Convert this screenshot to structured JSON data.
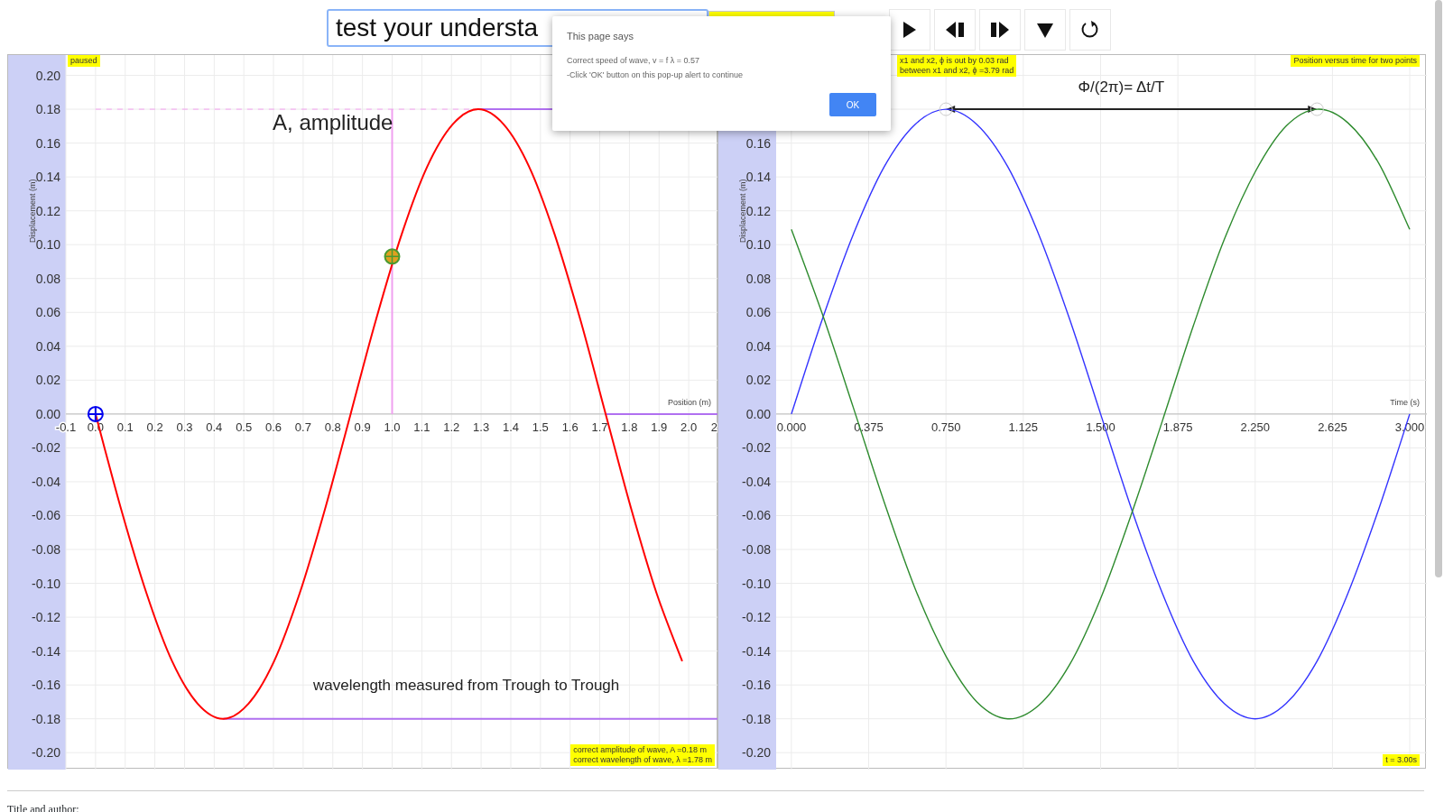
{
  "toolbar": {
    "question_select": {
      "value": "test your understa"
    },
    "buttons": [
      {
        "kind": "play"
      },
      {
        "kind": "step-back"
      },
      {
        "kind": "step-forward"
      },
      {
        "kind": "down"
      },
      {
        "kind": "reset"
      }
    ]
  },
  "dialog": {
    "title": "This page says",
    "message": [
      "Correct speed of wave, v = f λ = 0.57",
      "-Click 'OK' button on this pop-up alert to continue"
    ],
    "button": "OK"
  },
  "charts": [
    {
      "status": "paused",
      "notes": [
        "correct amplitude of wave, A =0.18 m",
        "correct wavelength of wave, λ =1.78 m"
      ],
      "chart_data": {
        "type": "line",
        "xlabel": "Position (m)",
        "ylabel": "Displacement (m)",
        "x": [
          0,
          0.086,
          0.172,
          0.258,
          0.344,
          0.43,
          0.516,
          0.602,
          0.688,
          0.774,
          0.86,
          0.946,
          1.032,
          1.118,
          1.204,
          1.29,
          1.376,
          1.462,
          1.548,
          1.634,
          1.72,
          1.806,
          1.892,
          1.978
        ],
        "series": [
          {
            "color": "#ff0000",
            "values": [
              0,
              -0.056,
              -0.106,
              -0.146,
              -0.171,
              -0.18,
              -0.171,
              -0.146,
              -0.106,
              -0.056,
              0,
              0.056,
              0.106,
              0.146,
              0.171,
              0.18,
              0.171,
              0.146,
              0.106,
              0.056,
              0,
              -0.056,
              -0.106,
              -0.146
            ]
          }
        ],
        "xlim": [
          -0.1,
          2.1
        ],
        "ylim": [
          -0.21,
          0.212
        ],
        "xticks": [
          {
            "value": -0.1,
            "label": "-0.1"
          },
          {
            "value": 0,
            "label": "0.0"
          },
          {
            "value": 0.1,
            "label": "0.1"
          },
          {
            "value": 0.2,
            "label": "0.2"
          },
          {
            "value": 0.3,
            "label": "0.3"
          },
          {
            "value": 0.4,
            "label": "0.4"
          },
          {
            "value": 0.5,
            "label": "0.5"
          },
          {
            "value": 0.6,
            "label": "0.6"
          },
          {
            "value": 0.7,
            "label": "0.7"
          },
          {
            "value": 0.8,
            "label": "0.8"
          },
          {
            "value": 0.9,
            "label": "0.9"
          },
          {
            "value": 1.0,
            "label": "1.0"
          },
          {
            "value": 1.1,
            "label": "1.1"
          },
          {
            "value": 1.2,
            "label": "1.2"
          },
          {
            "value": 1.3,
            "label": "1.3"
          },
          {
            "value": 1.4,
            "label": "1.4"
          },
          {
            "value": 1.5,
            "label": "1.5"
          },
          {
            "value": 1.6,
            "label": "1.6"
          },
          {
            "value": 1.7,
            "label": "1.7"
          },
          {
            "value": 1.8,
            "label": "1.8"
          },
          {
            "value": 1.9,
            "label": "1.9"
          },
          {
            "value": 2.0,
            "label": "2.0"
          },
          {
            "value": 2.1,
            "label": "2"
          }
        ],
        "yticks": [
          {
            "value": 0.2,
            "label": "0.20"
          },
          {
            "value": 0.18,
            "label": "0.18"
          },
          {
            "value": 0.16,
            "label": "0.16"
          },
          {
            "value": 0.14,
            "label": "0.14"
          },
          {
            "value": 0.12,
            "label": "0.12"
          },
          {
            "value": 0.1,
            "label": "0.10"
          },
          {
            "value": 0.08,
            "label": "0.08"
          },
          {
            "value": 0.06,
            "label": "0.06"
          },
          {
            "value": 0.04,
            "label": "0.04"
          },
          {
            "value": 0.02,
            "label": "0.02"
          },
          {
            "value": 0,
            "label": "0.00"
          },
          {
            "value": -0.02,
            "label": "-0.02"
          },
          {
            "value": -0.04,
            "label": "-0.04"
          },
          {
            "value": -0.06,
            "label": "-0.06"
          },
          {
            "value": -0.08,
            "label": "-0.08"
          },
          {
            "value": -0.1,
            "label": "-0.10"
          },
          {
            "value": -0.12,
            "label": "-0.12"
          },
          {
            "value": -0.14,
            "label": "-0.14"
          },
          {
            "value": -0.16,
            "label": "-0.16"
          },
          {
            "value": -0.18,
            "label": "-0.18"
          },
          {
            "value": -0.2,
            "label": "-0.20"
          }
        ],
        "grid": true,
        "ref_lines": [
          {
            "axis": "y",
            "value": 0.18,
            "color": "#f5a0f0"
          },
          {
            "axis": "y",
            "value": 0.18,
            "color": "#b070f0"
          },
          {
            "axis": "x",
            "value": 1.0,
            "color": "#f0a0f0"
          },
          {
            "axis": "y",
            "value": -0.18,
            "color": "#b070f0"
          },
          {
            "axis": "y",
            "value": 0,
            "color": "#b070f0"
          }
        ],
        "annotations": [
          "A, amplitude",
          "wavelength measured from Trough to Trough"
        ]
      }
    },
    {
      "status": "x1 and x2, ϕ is out by 0.03 rad",
      "status_2": "between x1 and x2, ϕ =3.79 rad",
      "title_label": "Position versus time for two points",
      "time": "t = 3.00s",
      "chart_data": {
        "type": "line",
        "xlabel": "Time (s)",
        "ylabel": "Displacement (m)",
        "x": [
          0,
          0.15,
          0.3,
          0.45,
          0.6,
          0.75,
          0.9,
          1.05,
          1.2,
          1.35,
          1.5,
          1.65,
          1.8,
          1.95,
          2.1,
          2.25,
          2.4,
          2.55,
          2.7,
          2.85,
          3.0
        ],
        "series": [
          {
            "color": "#3333ff",
            "values": [
              0,
              0.056,
              0.106,
              0.146,
              0.171,
              0.18,
              0.171,
              0.146,
              0.106,
              0.056,
              0,
              -0.056,
              -0.106,
              -0.146,
              -0.171,
              -0.18,
              -0.171,
              -0.146,
              -0.106,
              -0.056,
              0
            ]
          },
          {
            "color": "#2e8b2e",
            "values": [
              0.109,
              0.059,
              0.004,
              -0.052,
              -0.103,
              -0.143,
              -0.17,
              -0.18,
              -0.172,
              -0.148,
              -0.109,
              -0.059,
              -0.004,
              0.052,
              0.103,
              0.143,
              0.17,
              0.18,
              0.172,
              0.148,
              0.109
            ]
          }
        ],
        "xlim": [
          -0.074,
          3.083
        ],
        "ylim": [
          -0.21,
          0.212
        ],
        "xticks": [
          {
            "value": 0,
            "label": "0.000"
          },
          {
            "value": 0.375,
            "label": "0.375"
          },
          {
            "value": 0.75,
            "label": "0.750"
          },
          {
            "value": 1.125,
            "label": "1.125"
          },
          {
            "value": 1.5,
            "label": "1.500"
          },
          {
            "value": 1.875,
            "label": "1.875"
          },
          {
            "value": 2.25,
            "label": "2.250"
          },
          {
            "value": 2.625,
            "label": "2.625"
          },
          {
            "value": 3.0,
            "label": "3.000"
          }
        ],
        "yticks": [
          {
            "value": 0.16,
            "label": "0.16"
          },
          {
            "value": 0.14,
            "label": "0.14"
          },
          {
            "value": 0.12,
            "label": "0.12"
          },
          {
            "value": 0.1,
            "label": "0.10"
          },
          {
            "value": 0.08,
            "label": "0.08"
          },
          {
            "value": 0.06,
            "label": "0.06"
          },
          {
            "value": 0.04,
            "label": "0.04"
          },
          {
            "value": 0.02,
            "label": "0.02"
          },
          {
            "value": 0,
            "label": "0.00"
          },
          {
            "value": -0.02,
            "label": "-0.02"
          },
          {
            "value": -0.04,
            "label": "-0.04"
          },
          {
            "value": -0.06,
            "label": "-0.06"
          },
          {
            "value": -0.08,
            "label": "-0.08"
          },
          {
            "value": -0.1,
            "label": "-0.10"
          },
          {
            "value": -0.12,
            "label": "-0.12"
          },
          {
            "value": -0.14,
            "label": "-0.14"
          },
          {
            "value": -0.16,
            "label": "-0.16"
          },
          {
            "value": -0.18,
            "label": "-0.18"
          },
          {
            "value": -0.2,
            "label": "-0.20"
          }
        ],
        "grid": true,
        "annotations": [
          "Φ/(2π)= Δt/T"
        ]
      }
    }
  ],
  "footer": {
    "heading": "Title and author:"
  }
}
